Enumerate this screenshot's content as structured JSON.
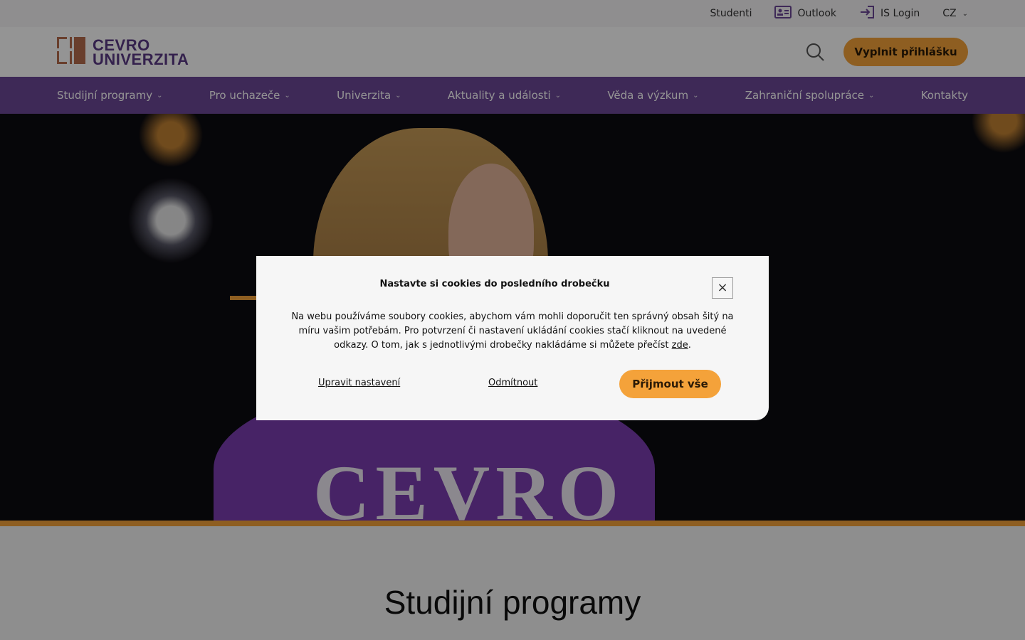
{
  "topbar": {
    "items": [
      {
        "label": "Studenti",
        "icon": ""
      },
      {
        "label": "Outlook",
        "icon": "id-card-icon"
      },
      {
        "label": "IS Login",
        "icon": "login-icon"
      },
      {
        "label": "CZ",
        "icon": "chevron-down-icon"
      }
    ]
  },
  "header": {
    "logo": {
      "line1": "CEVRO",
      "line2": "UNIVERZITA"
    },
    "cta_label": "Vyplnit přihlášku",
    "search_icon": "search-icon"
  },
  "nav": {
    "items": [
      {
        "label": "Studijní programy",
        "has_dropdown": true
      },
      {
        "label": "Pro uchazeče",
        "has_dropdown": true
      },
      {
        "label": "Univerzita",
        "has_dropdown": true
      },
      {
        "label": "Aktuality a události",
        "has_dropdown": true
      },
      {
        "label": "Věda a výzkum",
        "has_dropdown": true
      },
      {
        "label": "Zahraniční spolupráce",
        "has_dropdown": true
      },
      {
        "label": "Kontakty",
        "has_dropdown": false
      }
    ]
  },
  "hero": {
    "shirt_text": "CEVRO"
  },
  "sections": {
    "study_title": "Studijní programy"
  },
  "cookie_modal": {
    "title": "Nastavte si cookies do posledního drobečku",
    "body": "Na webu používáme soubory cookies, abychom vám mohli doporučit ten správný obsah šitý na míru vašim potřebám. Pro potvrzení či nastavení ukládání cookies stačí kliknout na uvedené odkazy. O tom, jak s jednotlivými drobečky nakládáme si můžete přečíst",
    "link_text": "zde",
    "close_symbol": "×",
    "actions": {
      "settings_label": "Upravit nastavení",
      "reject_label": "Odmítnout",
      "accept_label": "Přijmout vše"
    }
  },
  "colors": {
    "brand_purple": "#6c4896",
    "accent_orange": "#f4a23a",
    "logo_brown": "#b56b4c"
  }
}
